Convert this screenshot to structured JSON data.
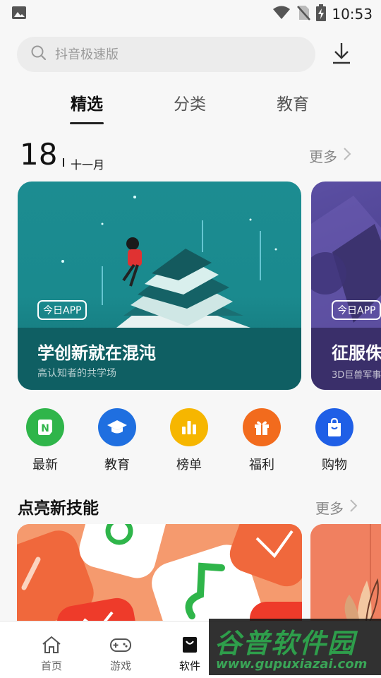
{
  "status_bar": {
    "time": "10:53"
  },
  "search": {
    "placeholder": "抖音极速版"
  },
  "tabs": [
    {
      "label": "精选",
      "active": true
    },
    {
      "label": "分类",
      "active": false
    },
    {
      "label": "教育",
      "active": false
    }
  ],
  "date": {
    "day": "18",
    "month": "十一月"
  },
  "more_label": "更多",
  "cards": [
    {
      "badge": "今日APP",
      "title": "学创新就在混沌",
      "subtitle": "高认知者的共学场",
      "color": "#1c8c91"
    },
    {
      "badge": "今日APP",
      "title": "征服侏",
      "subtitle": "3D巨兽军事",
      "color": "#4a3f8c"
    }
  ],
  "categories": [
    {
      "label": "最新",
      "icon": "new-icon",
      "color": "#2fb54a"
    },
    {
      "label": "教育",
      "icon": "graduation-cap-icon",
      "color": "#1f6fe0"
    },
    {
      "label": "榜单",
      "icon": "bar-chart-icon",
      "color": "#f6b600"
    },
    {
      "label": "福利",
      "icon": "gift-icon",
      "color": "#f26b1d"
    },
    {
      "label": "购物",
      "icon": "shopping-bag-icon",
      "color": "#1f5fe6"
    }
  ],
  "section": {
    "title": "点亮新技能"
  },
  "bottom_nav": [
    {
      "label": "首页",
      "icon": "home-icon",
      "active": false
    },
    {
      "label": "游戏",
      "icon": "gamepad-icon",
      "active": false
    },
    {
      "label": "软件",
      "icon": "software-bag-icon",
      "active": true
    }
  ],
  "watermark": {
    "title": "谷普软件园",
    "url": "www.gupuxiazai.com"
  }
}
